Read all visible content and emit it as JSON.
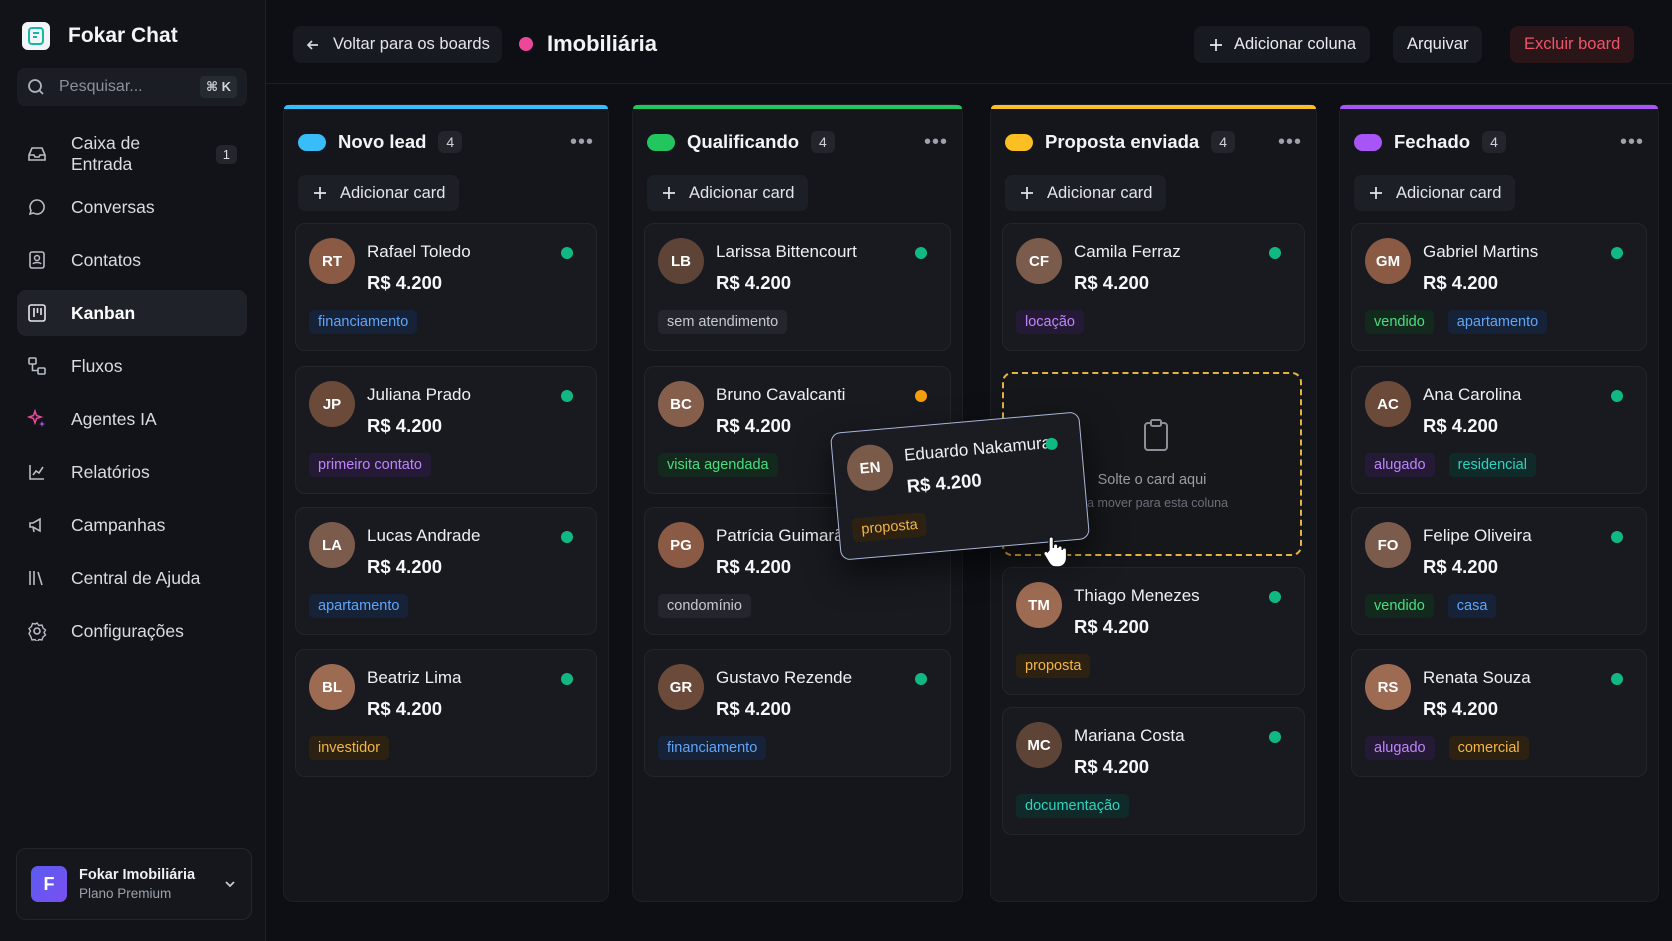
{
  "app": {
    "name": "Fokar Chat"
  },
  "search": {
    "placeholder": "Pesquisar...",
    "shortcut": "⌘ K"
  },
  "nav": [
    {
      "label": "Caixa de Entrada",
      "icon": "inbox-icon",
      "badge": "1"
    },
    {
      "label": "Conversas",
      "icon": "chat-bubble-icon"
    },
    {
      "label": "Contatos",
      "icon": "contacts-icon"
    },
    {
      "label": "Kanban",
      "icon": "kanban-icon",
      "active": true
    },
    {
      "label": "Fluxos",
      "icon": "flow-icon"
    },
    {
      "label": "Agentes IA",
      "icon": "sparkles-icon"
    },
    {
      "label": "Relatórios",
      "icon": "chart-icon"
    },
    {
      "label": "Campanhas",
      "icon": "megaphone-icon"
    },
    {
      "label": "Central de Ajuda",
      "icon": "library-icon"
    },
    {
      "label": "Configurações",
      "icon": "gear-icon"
    }
  ],
  "account": {
    "initial": "F",
    "name": "Fokar Imobiliária",
    "plan": "Plano Premium"
  },
  "header": {
    "back_label": "Voltar para os boards",
    "board_title": "Imobiliária",
    "board_color": "#ec4899",
    "add_column_label": "Adicionar coluna",
    "archive_label": "Arquivar",
    "delete_label": "Excluir board"
  },
  "add_card_label": "Adicionar card",
  "columns": [
    {
      "title": "Novo lead",
      "count": "4",
      "color": "#38bdf8",
      "cards": [
        {
          "name": "Rafael Toledo",
          "value": "R$ 4.200",
          "status": "#10b981",
          "tags": [
            {
              "text": "financiamento",
              "kind": "blue"
            }
          ]
        },
        {
          "name": "Juliana Prado",
          "value": "R$ 4.200",
          "status": "#10b981",
          "tags": [
            {
              "text": "primeiro contato",
              "kind": "purple"
            }
          ]
        },
        {
          "name": "Lucas Andrade",
          "value": "R$ 4.200",
          "status": "#10b981",
          "tags": [
            {
              "text": "apartamento",
              "kind": "blue"
            }
          ]
        },
        {
          "name": "Beatriz Lima",
          "value": "R$ 4.200",
          "status": "#10b981",
          "tags": [
            {
              "text": "investidor",
              "kind": "amber"
            }
          ]
        }
      ]
    },
    {
      "title": "Qualificando",
      "count": "4",
      "color": "#22c55e",
      "cards": [
        {
          "name": "Larissa Bittencourt",
          "value": "R$ 4.200",
          "status": "#10b981",
          "tags": [
            {
              "text": "sem atendimento",
              "kind": "gray"
            }
          ]
        },
        {
          "name": "Bruno Cavalcanti",
          "value": "R$ 4.200",
          "status": "#f59e0b",
          "tags": [
            {
              "text": "visita agendada",
              "kind": "green"
            }
          ]
        },
        {
          "name": "Patrícia Guimarã",
          "value": "R$ 4.200",
          "status": "",
          "tags": [
            {
              "text": "condomínio",
              "kind": "gray"
            }
          ]
        },
        {
          "name": "Gustavo Rezende",
          "value": "R$ 4.200",
          "status": "#10b981",
          "tags": [
            {
              "text": "financiamento",
              "kind": "blue"
            }
          ]
        }
      ]
    },
    {
      "title": "Proposta enviada",
      "count": "4",
      "color": "#fbbf24",
      "cards": [
        {
          "name": "Camila Ferraz",
          "value": "R$ 4.200",
          "status": "#10b981",
          "tags": [
            {
              "text": "locação",
              "kind": "purple"
            }
          ]
        },
        {
          "name": "Thiago Menezes",
          "value": "R$ 4.200",
          "status": "#10b981",
          "tags": [
            {
              "text": "proposta",
              "kind": "amber"
            }
          ]
        },
        {
          "name": "Mariana Costa",
          "value": "R$ 4.200",
          "status": "#10b981",
          "tags": [
            {
              "text": "documentação",
              "kind": "teal"
            }
          ]
        }
      ]
    },
    {
      "title": "Fechado",
      "count": "4",
      "color": "#a855f7",
      "cards": [
        {
          "name": "Gabriel Martins",
          "value": "R$ 4.200",
          "status": "#10b981",
          "tags": [
            {
              "text": "vendido",
              "kind": "green"
            },
            {
              "text": "apartamento",
              "kind": "blue"
            }
          ]
        },
        {
          "name": "Ana Carolina",
          "value": "R$ 4.200",
          "status": "#10b981",
          "tags": [
            {
              "text": "alugado",
              "kind": "purple"
            },
            {
              "text": "residencial",
              "kind": "teal"
            }
          ]
        },
        {
          "name": "Felipe Oliveira",
          "value": "R$ 4.200",
          "status": "#10b981",
          "tags": [
            {
              "text": "vendido",
              "kind": "green"
            },
            {
              "text": "casa",
              "kind": "blue"
            }
          ]
        },
        {
          "name": "Renata Souza",
          "value": "R$ 4.200",
          "status": "#10b981",
          "tags": [
            {
              "text": "alugado",
              "kind": "purple"
            },
            {
              "text": "comercial",
              "kind": "amber"
            }
          ]
        }
      ]
    }
  ],
  "dropzone": {
    "title": "Solte o card aqui",
    "subtitle": "ara mover para esta coluna"
  },
  "dragging_card": {
    "name": "Eduardo Nakamura",
    "value": "R$ 4.200",
    "status": "#10b981",
    "tag": "proposta"
  }
}
